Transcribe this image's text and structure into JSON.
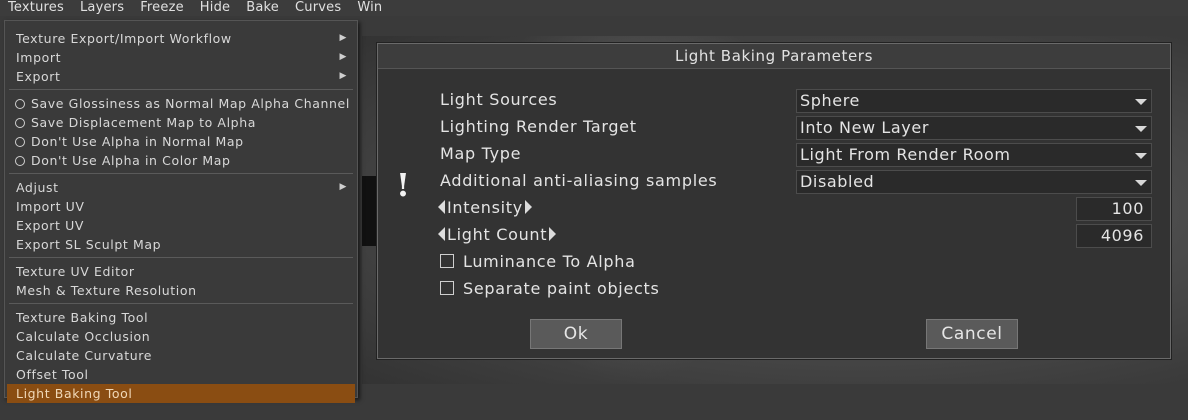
{
  "menubar": {
    "items": [
      "Textures",
      "Layers",
      "Freeze",
      "Hide",
      "Bake",
      "Curves",
      "Win"
    ]
  },
  "menu": {
    "items": [
      {
        "label": "Texture Export/Import Workflow",
        "submenu": true
      },
      {
        "label": "Import",
        "submenu": true
      },
      {
        "label": "Export",
        "submenu": true
      },
      {
        "label": "Save Glossiness as Normal Map Alpha Channel",
        "radio": true
      },
      {
        "label": "Save Displacement Map to Alpha",
        "radio": true
      },
      {
        "label": "Don't Use Alpha in Normal Map",
        "radio": true
      },
      {
        "label": "Don't Use Alpha in Color Map",
        "radio": true
      },
      {
        "label": "Adjust",
        "submenu": true
      },
      {
        "label": "Import UV"
      },
      {
        "label": "Export UV"
      },
      {
        "label": "Export SL Sculpt Map"
      },
      {
        "label": "Texture UV Editor"
      },
      {
        "label": "Mesh & Texture Resolution"
      },
      {
        "label": "Texture Baking Tool"
      },
      {
        "label": "Calculate Occlusion"
      },
      {
        "label": "Calculate Curvature"
      },
      {
        "label": "Offset Tool"
      },
      {
        "label": "Light Baking Tool",
        "active": true
      }
    ],
    "active_color": "#8a4d12"
  },
  "dialog": {
    "title": "Light Baking Parameters",
    "warning_glyph": "!",
    "light_sources": {
      "label": "Light Sources",
      "value": "Sphere"
    },
    "render_target": {
      "label": "Lighting Render Target",
      "value": "Into New Layer"
    },
    "map_type": {
      "label": "Map Type",
      "value": "Light From Render Room"
    },
    "aa_samples": {
      "label": "Additional anti-aliasing samples",
      "value": "Disabled"
    },
    "intensity": {
      "label": "Intensity",
      "value": "100"
    },
    "light_count": {
      "label": "Light Count",
      "value": "4096"
    },
    "luminance_to_alpha": {
      "label": "Luminance To Alpha",
      "checked": false
    },
    "separate_paint": {
      "label": "Separate paint objects",
      "checked": false
    },
    "ok_label": "Ok",
    "cancel_label": "Cancel"
  }
}
